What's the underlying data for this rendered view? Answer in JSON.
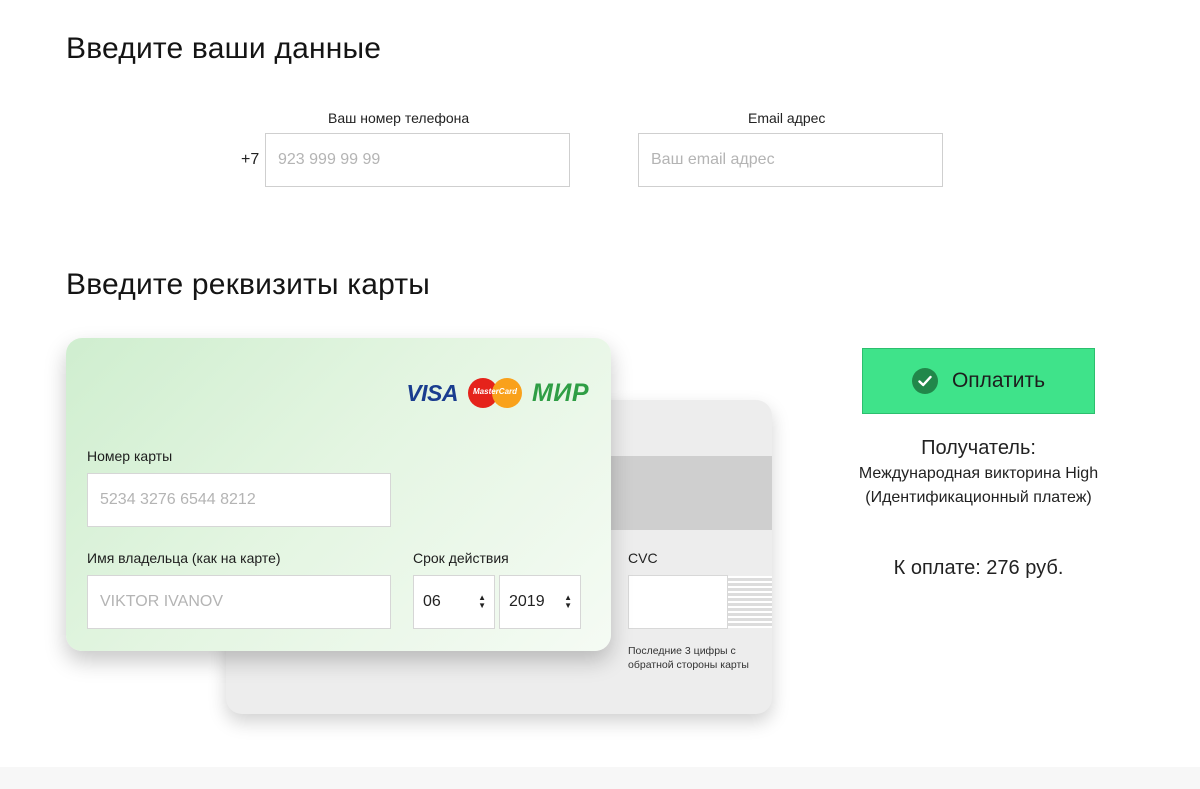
{
  "contact": {
    "heading": "Введите ваши данные",
    "phone_label": "Ваш номер телефона",
    "phone_prefix": "+7",
    "phone_placeholder": "923 999 99 99",
    "email_label": "Email адрес",
    "email_placeholder": "Ваш email адрес"
  },
  "card": {
    "heading": "Введите реквизиты карты",
    "logos": {
      "visa": "VISA",
      "mastercard": "MasterCard",
      "mir": "МИР"
    },
    "number_label": "Номер карты",
    "number_placeholder": "5234 3276 6544 8212",
    "holder_label": "Имя владельца (как на карте)",
    "holder_placeholder": "VIKTOR IVANOV",
    "expiry_label": "Срок действия",
    "expiry_month": "06",
    "expiry_year": "2019",
    "cvc_label": "CVC",
    "cvc_hint": "Последние 3 цифры с обратной стороны карты"
  },
  "payment": {
    "button_label": "Оплатить",
    "recipient_title": "Получатель:",
    "recipient_name": "Международная викторина High",
    "recipient_note": "(Идентификационный платеж)",
    "total": "К оплате: 276 руб."
  },
  "colors": {
    "pay_button": "#3fe38a",
    "card_front": "#d6f0d4",
    "visa_blue": "#1a3d8f",
    "mir_green": "#2f9e45"
  }
}
